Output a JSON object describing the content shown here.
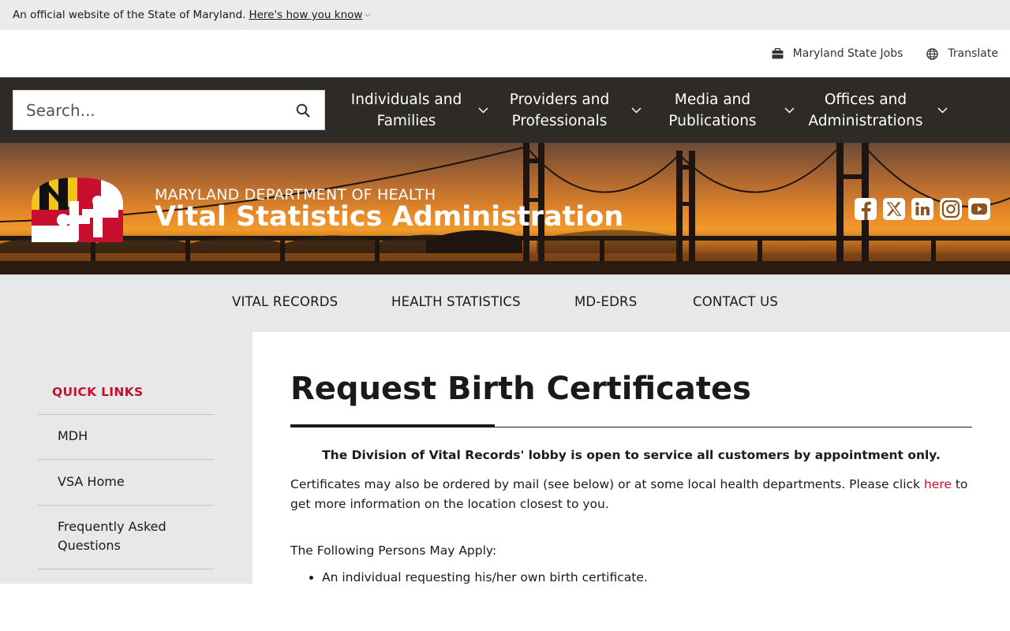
{
  "official_banner": {
    "text": "An official website of the State of Maryland.",
    "link": "Here's how you know",
    "caret_icon": "chevron-down-icon"
  },
  "utility": {
    "jobs_label": "Maryland State Jobs",
    "jobs_icon": "briefcase-icon",
    "translate_label": "Translate",
    "translate_icon": "globe-icon"
  },
  "search": {
    "placeholder": "Search...",
    "icon": "search-icon"
  },
  "nav": {
    "items": [
      {
        "line1": "Individuals and",
        "line2": "Families"
      },
      {
        "line1": "Providers and",
        "line2": "Professionals"
      },
      {
        "line1": "Media and",
        "line2": "Publications"
      },
      {
        "line1": "Offices and",
        "line2": "Administrations"
      }
    ]
  },
  "hero": {
    "department": "MARYLAND DEPARTMENT OF HEALTH",
    "administration": "Vital Statistics Administration",
    "social": [
      "facebook-icon",
      "x-twitter-icon",
      "linkedin-icon",
      "instagram-icon",
      "youtube-icon"
    ]
  },
  "subnav": {
    "links": [
      "VITAL RECORDS",
      "HEALTH STATISTICS",
      "MD-EDRS",
      "CONTACT US"
    ]
  },
  "sidebar": {
    "title": "QUICK LINKS",
    "items": [
      "MDH",
      "VSA Home",
      "Frequently Asked Questions"
    ]
  },
  "content": {
    "title": "Request Birth Certificates",
    "notice": "The Division of Vital Records' lobby is open to service all customers by appointment only.",
    "para_before": "Certificates may also be ordered by mail (see below) or at some local health departments. Please click ",
    "para_link": "here",
    "para_after": " to get more information on the location closest to you.",
    "apply_label": "The Following Persons May Apply:",
    "bullets": [
      "An individual requesting his/her own birth certificate."
    ]
  },
  "colors": {
    "accent_red": "#c8102e",
    "nav_bg": "#2e2b26",
    "subnav_bg": "#e6e8ea"
  }
}
